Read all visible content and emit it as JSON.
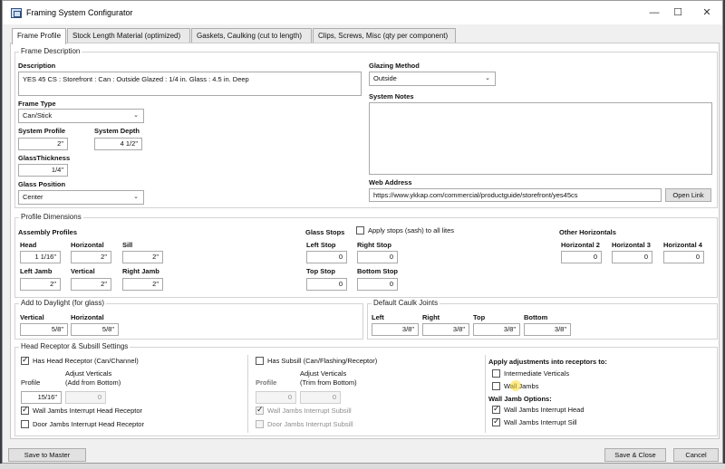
{
  "window": {
    "title": "Framing System Configurator",
    "minimize": "—",
    "maximize": "☐",
    "close": "✕"
  },
  "tabs": [
    "Frame Profile",
    "Stock Length Material (optimized)",
    "Gaskets, Caulking (cut to length)",
    "Clips, Screws, Misc (qty per component)"
  ],
  "frame_description": {
    "group_title": "Frame Description",
    "description_label": "Description",
    "description_value": "YES 45 CS : Storefront : Can : Outside Glazed : 1/4 in. Glass : 4.5 in. Deep",
    "frame_type_label": "Frame Type",
    "frame_type_value": "Can/Stick",
    "system_profile_label": "System Profile",
    "system_profile_value": "2\"",
    "system_depth_label": "System Depth",
    "system_depth_value": "4 1/2\"",
    "glass_thickness_label": "GlassThickness",
    "glass_thickness_value": "1/4\"",
    "glass_position_label": "Glass Position",
    "glass_position_value": "Center",
    "glazing_method_label": "Glazing Method",
    "glazing_method_value": "Outside",
    "system_notes_label": "System Notes",
    "system_notes_value": "",
    "web_address_label": "Web Address",
    "web_address_value": "https://www.ykkap.com/commercial/productguide/storefront/yes45cs",
    "open_link_label": "Open Link"
  },
  "profile_dimensions": {
    "group_title": "Profile Dimensions",
    "assembly_profiles_label": "Assembly Profiles",
    "head_label": "Head",
    "head_value": "1 1/16\"",
    "horizontal_label": "Horizontal",
    "horizontal_value": "2\"",
    "sill_label": "Sill",
    "sill_value": "2\"",
    "left_jamb_label": "Left Jamb",
    "left_jamb_value": "2\"",
    "vertical_label": "Vertical",
    "vertical_value": "2\"",
    "right_jamb_label": "Right Jamb",
    "right_jamb_value": "2\"",
    "glass_stops_label": "Glass Stops",
    "apply_stops_label": "Apply stops (sash) to all lites",
    "left_stop_label": "Left Stop",
    "left_stop_value": "0",
    "right_stop_label": "Right Stop",
    "right_stop_value": "0",
    "top_stop_label": "Top Stop",
    "top_stop_value": "0",
    "bottom_stop_label": "Bottom Stop",
    "bottom_stop_value": "0",
    "other_horizontals_label": "Other Horizontals",
    "horizontal2_label": "Horizontal 2",
    "horizontal2_value": "0",
    "horizontal3_label": "Horizontal 3",
    "horizontal3_value": "0",
    "horizontal4_label": "Horizontal 4",
    "horizontal4_value": "0"
  },
  "add_to_daylight": {
    "group_title": "Add to Daylight (for glass)",
    "vertical_label": "Vertical",
    "vertical_value": "5/8\"",
    "horizontal_label": "Horizontal",
    "horizontal_value": "5/8\""
  },
  "caulk_joints": {
    "group_title": "Default Caulk Joints",
    "left_label": "Left",
    "left_value": "3/8\"",
    "right_label": "Right",
    "right_value": "3/8\"",
    "top_label": "Top",
    "top_value": "3/8\"",
    "bottom_label": "Bottom",
    "bottom_value": "3/8\""
  },
  "receptor": {
    "group_title": "Head Receptor & Subsill Settings",
    "has_head_label": "Has Head Receptor (Can/Channel)",
    "profile_label": "Profile",
    "adjust_verticals_label": "Adjust Verticals",
    "add_from_bottom_label": "(Add from Bottom)",
    "head_profile_value": "15/16\"",
    "head_adjust_value": "0",
    "wall_jambs_head_label": "Wall Jambs Interrupt Head Receptor",
    "door_jambs_head_label": "Door Jambs Interrupt Head Receptor",
    "has_subsill_label": "Has Subsill (Can/Flashing/Receptor)",
    "subsill_profile_label": "Profile",
    "subsill_adjust_label": "Adjust Verticals",
    "trim_from_bottom_label": "(Trim from Bottom)",
    "subsill_profile_value": "0",
    "subsill_adjust_value": "0",
    "wall_jambs_subsill_label": "Wall Jambs Interrupt Subsill",
    "door_jambs_subsill_label": "Door Jambs Interrupt Subsill",
    "apply_adjustments_label": "Apply adjustments into receptors to:",
    "intermediate_verticals_label": "Intermediate Verticals",
    "wall_jambs_label": "Wall Jambs",
    "wall_jamb_options_label": "Wall Jamb Options:",
    "wall_jambs_interrupt_head_label": "Wall Jambs Interrupt Head",
    "wall_jambs_interrupt_sill_label": "Wall Jambs Interrupt Sill"
  },
  "footer": {
    "save_to_master": "Save to Master",
    "save_close": "Save & Close",
    "cancel": "Cancel"
  }
}
